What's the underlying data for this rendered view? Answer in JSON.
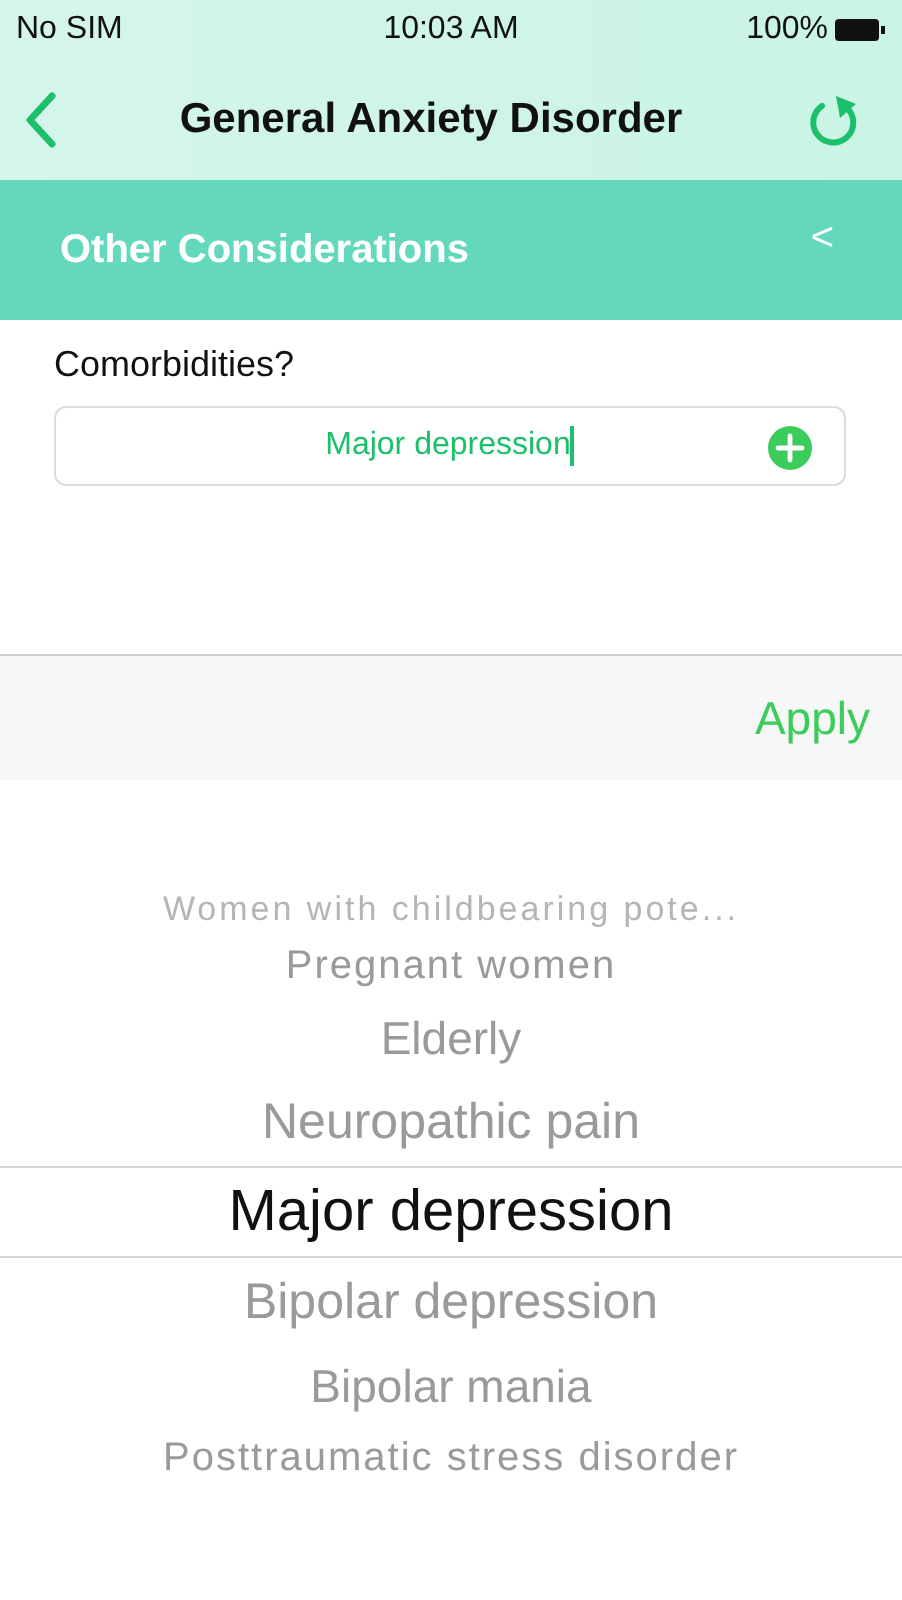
{
  "status_bar": {
    "carrier": "No SIM",
    "time": "10:03 AM",
    "battery": "100%"
  },
  "nav": {
    "title": "General Anxiety Disorder"
  },
  "section": {
    "title": "Other Considerations",
    "toggle": "<"
  },
  "question": {
    "label": "Comorbidities?",
    "value": "Major depression"
  },
  "toolbar": {
    "apply": "Apply"
  },
  "picker": {
    "items": [
      {
        "label": "Women with childbearing pote...",
        "selected": false
      },
      {
        "label": "Pregnant women",
        "selected": false
      },
      {
        "label": "Elderly",
        "selected": false
      },
      {
        "label": "Neuropathic pain",
        "selected": false
      },
      {
        "label": "Major depression",
        "selected": true
      },
      {
        "label": "Bipolar depression",
        "selected": false
      },
      {
        "label": "Bipolar mania",
        "selected": false
      },
      {
        "label": "Posttraumatic stress disorder",
        "selected": false
      }
    ]
  }
}
